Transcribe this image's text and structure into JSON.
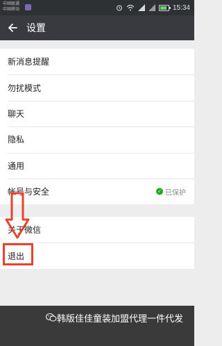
{
  "status": {
    "carriers": [
      "中国联通",
      "中国移动"
    ],
    "time": "15:34"
  },
  "header": {
    "title": "设置"
  },
  "menu": {
    "group1": [
      {
        "label": "新消息提醒"
      },
      {
        "label": "勿扰模式"
      },
      {
        "label": "聊天"
      },
      {
        "label": "隐私"
      },
      {
        "label": "通用"
      },
      {
        "label": "帐号与安全",
        "status": "已保护"
      }
    ],
    "group2": [
      {
        "label": "关于微信"
      },
      {
        "label": "退出"
      }
    ]
  },
  "watermark": {
    "text": "韩版佳佳童装加盟代理一件代发"
  },
  "colors": {
    "appbar": "#393a3f",
    "statusbar": "#2e3134",
    "highlight": "#e8432a",
    "protected": "#1aad19"
  }
}
